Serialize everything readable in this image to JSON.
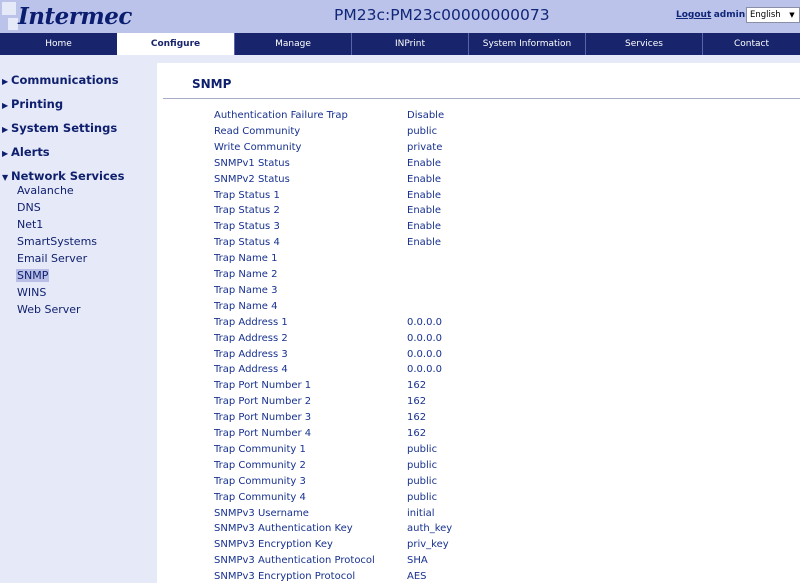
{
  "header": {
    "logo_text": "Intermec",
    "device_title": "PM23c:PM23c00000000073",
    "logout_label": "Logout",
    "user_label": ": admin",
    "language_selected": "English"
  },
  "nav": {
    "tabs": [
      {
        "label": "Home"
      },
      {
        "label": "Configure"
      },
      {
        "label": "Manage"
      },
      {
        "label": "INPrint"
      },
      {
        "label": "System Information"
      },
      {
        "label": "Services"
      },
      {
        "label": "Contact"
      }
    ],
    "active_tab": "Configure"
  },
  "sidebar": {
    "categories": [
      {
        "label": "Communications",
        "expanded": false
      },
      {
        "label": "Printing",
        "expanded": false
      },
      {
        "label": "System Settings",
        "expanded": false
      },
      {
        "label": "Alerts",
        "expanded": false
      },
      {
        "label": "Network Services",
        "expanded": true
      }
    ],
    "network_services_items": [
      {
        "label": "Avalanche"
      },
      {
        "label": "DNS"
      },
      {
        "label": "Net1"
      },
      {
        "label": "SmartSystems"
      },
      {
        "label": "Email Server"
      },
      {
        "label": "SNMP"
      },
      {
        "label": "WINS"
      },
      {
        "label": "Web Server"
      }
    ],
    "selected_item": "SNMP"
  },
  "main": {
    "title": "SNMP",
    "settings": [
      {
        "label": "Authentication Failure Trap",
        "value": "Disable"
      },
      {
        "label": "Read Community",
        "value": "public"
      },
      {
        "label": "Write Community",
        "value": "private"
      },
      {
        "label": "SNMPv1 Status",
        "value": "Enable"
      },
      {
        "label": "SNMPv2 Status",
        "value": "Enable"
      },
      {
        "label": "Trap Status 1",
        "value": "Enable"
      },
      {
        "label": "Trap Status 2",
        "value": "Enable"
      },
      {
        "label": "Trap Status 3",
        "value": "Enable"
      },
      {
        "label": "Trap Status 4",
        "value": "Enable"
      },
      {
        "label": "Trap Name 1",
        "value": ""
      },
      {
        "label": "Trap Name 2",
        "value": ""
      },
      {
        "label": "Trap Name 3",
        "value": ""
      },
      {
        "label": "Trap Name 4",
        "value": ""
      },
      {
        "label": "Trap Address 1",
        "value": "0.0.0.0"
      },
      {
        "label": "Trap Address 2",
        "value": "0.0.0.0"
      },
      {
        "label": "Trap Address 3",
        "value": "0.0.0.0"
      },
      {
        "label": "Trap Address 4",
        "value": "0.0.0.0"
      },
      {
        "label": "Trap Port Number 1",
        "value": "162"
      },
      {
        "label": "Trap Port Number 2",
        "value": "162"
      },
      {
        "label": "Trap Port Number 3",
        "value": "162"
      },
      {
        "label": "Trap Port Number 4",
        "value": "162"
      },
      {
        "label": "Trap Community 1",
        "value": "public"
      },
      {
        "label": "Trap Community 2",
        "value": "public"
      },
      {
        "label": "Trap Community 3",
        "value": "public"
      },
      {
        "label": "Trap Community 4",
        "value": "public"
      },
      {
        "label": "SNMPv3 Username",
        "value": "initial"
      },
      {
        "label": "SNMPv3 Authentication Key",
        "value": "auth_key"
      },
      {
        "label": "SNMPv3 Encryption Key",
        "value": "priv_key"
      },
      {
        "label": "SNMPv3 Authentication Protocol",
        "value": "SHA"
      },
      {
        "label": "SNMPv3 Encryption Protocol",
        "value": "AES"
      }
    ]
  },
  "colors": {
    "header_bg": "#bcc3ea",
    "nav_bg": "#18256c",
    "sidebar_bg": "#e6e9f8",
    "text_primary": "#17318f"
  }
}
